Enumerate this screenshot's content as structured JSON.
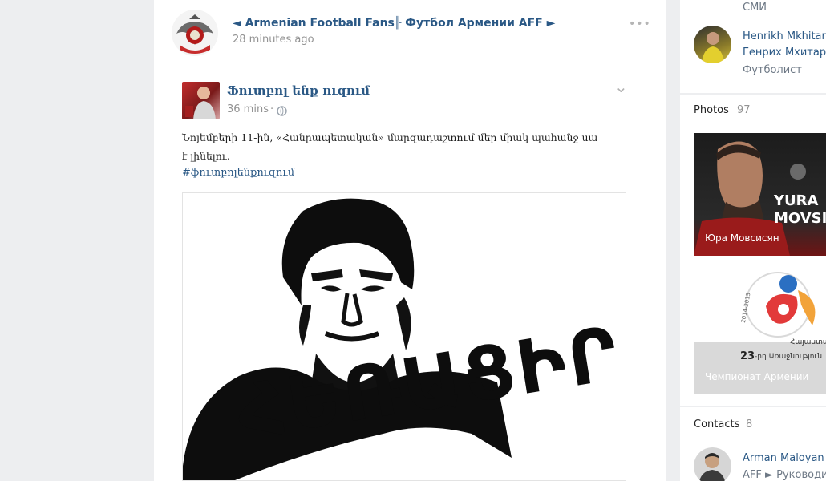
{
  "post": {
    "group_name": "◄ Armenian Football Fans╟ Футбол Армении AFF ►",
    "timestamp": "28 minutes ago",
    "menu_glyph": "•••"
  },
  "shared": {
    "author": "Ֆուտբոլ ենք ուզում",
    "time": "36 mins",
    "separator": "·",
    "chevron": "⌄",
    "text_line1": "Նոյեմբերի 11-ին, «Հանրապետական» մարզադաշտում մեր միակ պահանջ սա",
    "text_line2": "է լինելու.",
    "hashtag": "#ֆուտբոլենքուզում",
    "image_caption": "ՀԵՌԱՑԻՐ"
  },
  "sidebar": {
    "top_fragment": "СМИ",
    "person": {
      "name_line1": "Henrikh Mkhitaryan",
      "name_line2": "Генрих Мхитарян",
      "role": "Футболист"
    },
    "photos": {
      "title": "Photos",
      "count": "97",
      "album1_overlay": "YURA",
      "album1_overlay2": "MOVSISYAN",
      "album1_caption": "Юра Мовсисян",
      "album2_years": "2014-2015",
      "album2_text_small": "Հայաստանի",
      "album2_number": "23",
      "album2_suffix": "-րդ Առաջնություն",
      "album2_caption": "Чемпионат Армении"
    },
    "contacts": {
      "title": "Contacts",
      "count": "8",
      "name": "Arman Maloyan",
      "role": "AFF ► Руководитель"
    }
  }
}
